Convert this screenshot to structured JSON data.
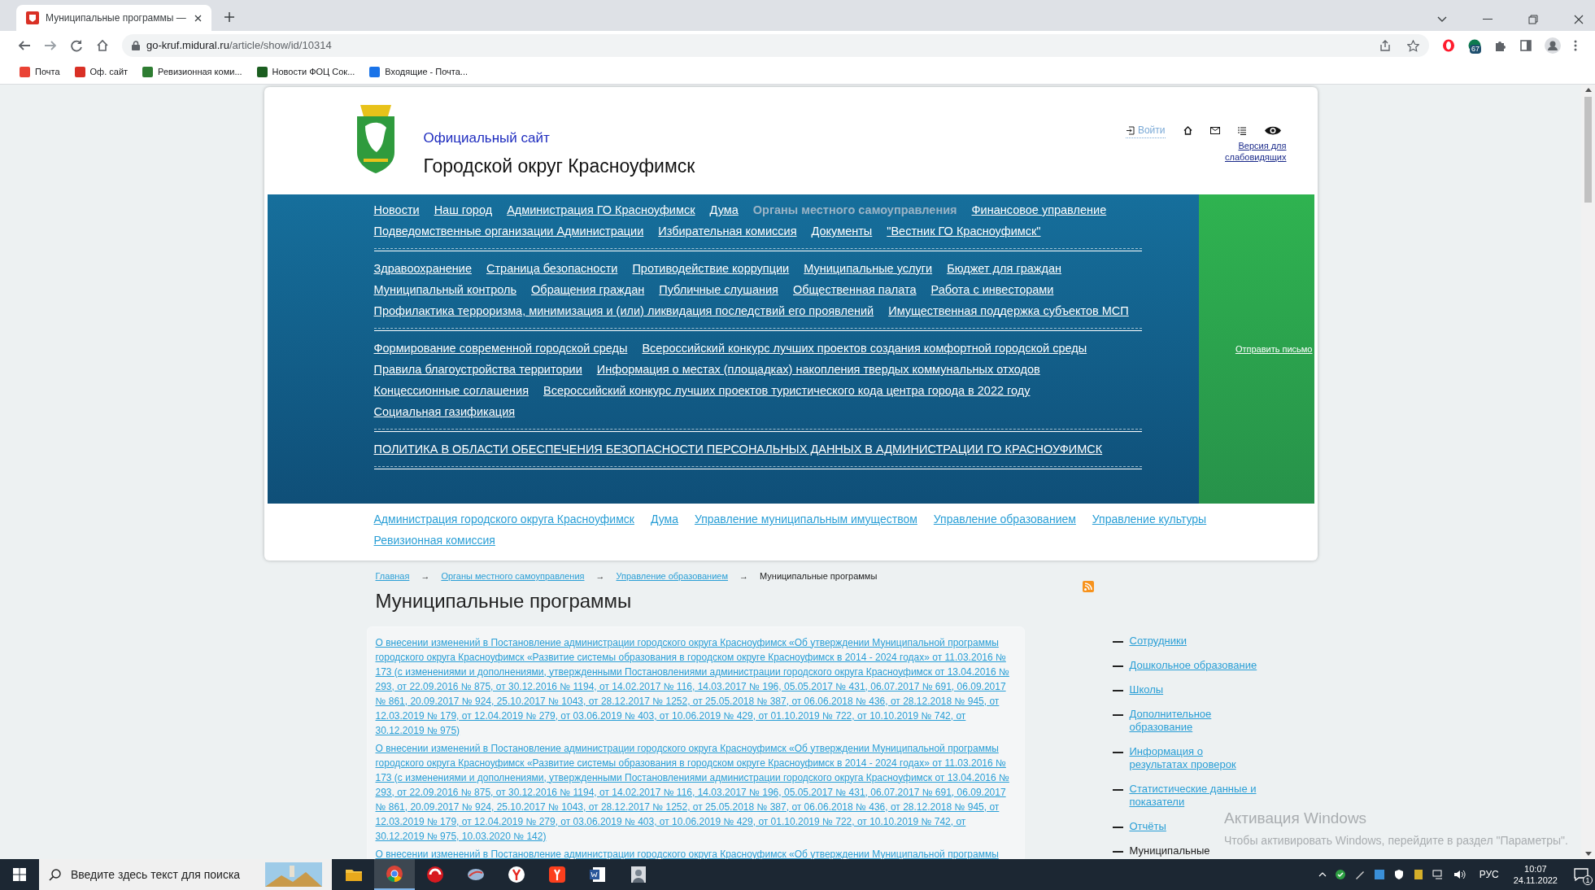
{
  "browser": {
    "tab_title": "Муниципальные программы —",
    "url_host": "go-kruf.midural.ru",
    "url_path": "/article/show/id/10314",
    "extension_badge": "67",
    "bookmarks": [
      {
        "label": "Почта",
        "color": "#ea4335"
      },
      {
        "label": "Оф. сайт",
        "color": "#d93025"
      },
      {
        "label": "Ревизионная коми...",
        "color": "#2e7d32"
      },
      {
        "label": "Новости ФОЦ Сок...",
        "color": "#1b5e20"
      },
      {
        "label": "Входящие - Почта...",
        "color": "#1a73e8"
      }
    ]
  },
  "header": {
    "site_label": "Официальный сайт",
    "site_name": "Городской округ Красноуфимск",
    "login": "Войти",
    "accessibility_link": "Версия для слабовидящих"
  },
  "nav": {
    "groups": [
      [
        {
          "label": "Новости",
          "selected": false
        },
        {
          "label": "Наш город",
          "selected": false
        },
        {
          "label": "Администрация ГО Красноуфимск",
          "selected": false
        },
        {
          "label": "Дума",
          "selected": false
        },
        {
          "label": "Органы местного самоуправления",
          "selected": true
        },
        {
          "label": "Финансовое управление",
          "selected": false
        },
        {
          "label": "Подведомственные организации Администрации",
          "selected": false
        },
        {
          "label": "Избирательная комиссия",
          "selected": false
        },
        {
          "label": "Документы",
          "selected": false
        },
        {
          "label": "\"Вестник ГО Красноуфимск\"",
          "selected": false
        }
      ],
      [
        {
          "label": "Здравоохранение",
          "selected": false
        },
        {
          "label": "Страница безопасности",
          "selected": false
        },
        {
          "label": "Противодействие коррупции",
          "selected": false
        },
        {
          "label": "Муниципальные услуги",
          "selected": false
        },
        {
          "label": "Бюджет для граждан",
          "selected": false
        },
        {
          "label": "Муниципальный контроль",
          "selected": false
        },
        {
          "label": "Обращения граждан",
          "selected": false
        },
        {
          "label": "Публичные слушания",
          "selected": false
        },
        {
          "label": "Общественная палата",
          "selected": false
        },
        {
          "label": "Работа с инвесторами",
          "selected": false
        },
        {
          "label": "Профилактика терроризма, минимизация и (или) ликвидация последствий его проявлений",
          "selected": false
        },
        {
          "label": "Имущественная поддержка субъектов МСП",
          "selected": false
        }
      ],
      [
        {
          "label": "Формирование современной городской среды",
          "selected": false
        },
        {
          "label": "Всероссийский конкурс лучших проектов создания комфортной городской среды",
          "selected": false
        },
        {
          "label": "Правила благоустройства территории",
          "selected": false
        },
        {
          "label": "Информация о местах (площадках) накопления твердых коммунальных отходов",
          "selected": false
        },
        {
          "label": "Концессионные соглашения",
          "selected": false
        },
        {
          "label": "Всероссийский конкурс лучших проектов туристического кода центра города в 2022 году",
          "selected": false
        },
        {
          "label": "Социальная газификация",
          "selected": false
        }
      ],
      [
        {
          "label": "ПОЛИТИКА В ОБЛАСТИ ОБЕСПЕЧЕНИЯ БЕЗОПАСНОСТИ ПЕРСОНАЛЬНЫХ ДАННЫХ В АДМИНИСТРАЦИИ ГО КРАСНОУФИМСК",
          "selected": false
        }
      ]
    ],
    "send_letter": "Отправить письмо"
  },
  "subnav": [
    "Администрация городского округа Красноуфимск",
    "Дума",
    "Управление муниципальным имуществом",
    "Управление образованием",
    "Управление культуры",
    "Ревизионная комиссия"
  ],
  "breadcrumb": {
    "links": [
      "Главная",
      "Органы местного самоуправления",
      "Управление образованием"
    ],
    "separator": "→",
    "current": "Муниципальные программы"
  },
  "title": "Муниципальные программы",
  "documents": [
    "О внесении изменений в Постановление администрации городского округа Красноуфимск «Об утверждении Муниципальной программы городского округа Красноуфимск «Развитие системы образования в городском округе Красноуфимск в 2014 - 2024 годах» от 11.03.2016 № 173 (с изменениями и дополнениями, утвержденными Постановлениями администрации городского округа Красноуфимск от 13.04.2016 № 293, от 22.09.2016 № 875, от 30.12.2016 № 1194, от 14.02.2017 № 116, 14.03.2017 № 196, 05.05.2017 № 431, 06.07.2017 № 691, 06.09.2017 № 861, 20.09.2017 № 924, 25.10.2017 № 1043, от 28.12.2017 № 1252, от 25.05.2018 № 387, от 06.06.2018 № 436, от 28.12.2018 № 945, от 12.03.2019 № 179, от 12.04.2019 № 279, от 03.06.2019 № 403, от 10.06.2019 № 429, от 01.10.2019 № 722, от 10.10.2019 № 742, от 30.12.2019 № 975)",
    "О внесении изменений в Постановление администрации городского округа Красноуфимск «Об утверждении Муниципальной программы городского округа Красноуфимск «Развитие системы образования в городском округе Красноуфимск в 2014 - 2024 годах» от 11.03.2016 № 173 (с изменениями и дополнениями, утвержденными Постановлениями администрации городского округа Красноуфимск от 13.04.2016 № 293, от 22.09.2016 № 875, от 30.12.2016 № 1194, от 14.02.2017 № 116, 14.03.2017 № 196, 05.05.2017 № 431, 06.07.2017 № 691, 06.09.2017 № 861, 20.09.2017 № 924, 25.10.2017 № 1043, от 28.12.2017 № 1252, от 25.05.2018 № 387, от 06.06.2018 № 436, от 28.12.2018 № 945, от 12.03.2019 № 179, от 12.04.2019 № 279, от 03.06.2019 № 403, от 10.06.2019 № 429, от 01.10.2019 № 722, от 10.10.2019 № 742, от 30.12.2019 № 975, 10.03.2020 № 142)",
    "О внесении изменений в Постановление администрации городского округа Красноуфимск «Об утверждении Муниципальной программы"
  ],
  "sidebar": [
    {
      "label": "Сотрудники",
      "selected": false
    },
    {
      "label": "Дошкольное образование",
      "selected": false
    },
    {
      "label": "Школы",
      "selected": false
    },
    {
      "label": "Дополнительное образование",
      "selected": false
    },
    {
      "label": "Информация о результатах проверок",
      "selected": false
    },
    {
      "label": "Статистические данные и показатели",
      "selected": false
    },
    {
      "label": "Отчёты",
      "selected": false
    },
    {
      "label": "Муниципальные",
      "selected": true
    }
  ],
  "activation": {
    "title": "Активация Windows",
    "text": "Чтобы активировать Windows, перейдите в раздел \"Параметры\"."
  },
  "taskbar": {
    "search_placeholder": "Введите здесь текст для поиска",
    "apps": [
      {
        "kind": "folder",
        "selected": false
      },
      {
        "kind": "chrome",
        "selected": true
      },
      {
        "kind": "red",
        "selected": false
      },
      {
        "kind": "globe",
        "selected": false
      },
      {
        "kind": "y-circle",
        "selected": false
      },
      {
        "kind": "y-square",
        "selected": false
      },
      {
        "kind": "word",
        "selected": false
      },
      {
        "kind": "picture",
        "selected": false
      }
    ],
    "language": "РУС",
    "time": "10:07",
    "date": "24.11.2022",
    "notifications": "1"
  }
}
